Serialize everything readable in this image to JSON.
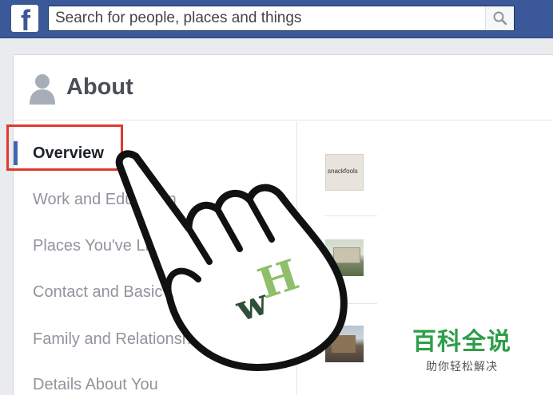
{
  "topbar": {
    "logo_letter": "f",
    "search": {
      "placeholder": "Search for people, places and things",
      "value": ""
    }
  },
  "about": {
    "title": "About"
  },
  "sidebar": {
    "items": [
      {
        "label": "Overview",
        "active": true
      },
      {
        "label": "Work and Education",
        "active": false
      },
      {
        "label": "Places You've Lived",
        "active": false
      },
      {
        "label": "Contact and Basic Info",
        "active": false
      },
      {
        "label": "Family and Relationships",
        "active": false
      },
      {
        "label": "Details About You",
        "active": false
      }
    ]
  },
  "content": {
    "thumbnails": [
      {
        "name": "snackfools-logo",
        "text": "snackfools"
      },
      {
        "name": "building-photo"
      },
      {
        "name": "city-photo"
      }
    ]
  },
  "overlay": {
    "watermark": "wH",
    "brand_title": "百科全说",
    "brand_subtitle": "助你轻松解决"
  },
  "colors": {
    "facebook_blue": "#3b5998",
    "highlight_red": "#e0392e",
    "watermark_green": "#8fbf6a",
    "brand_green": "#2e9e4a"
  }
}
